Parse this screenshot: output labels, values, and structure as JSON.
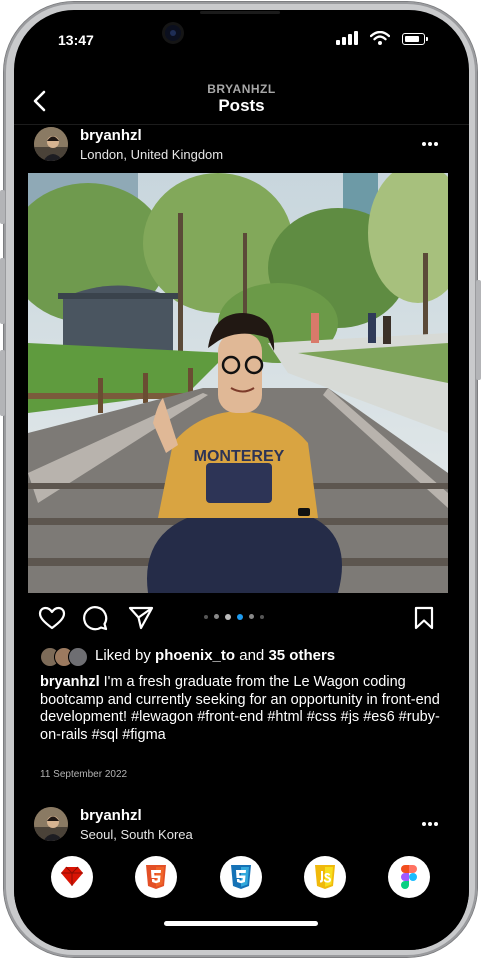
{
  "status_bar": {
    "time": "13:47"
  },
  "header": {
    "username": "BRYANHZL",
    "title": "Posts"
  },
  "post": {
    "username": "bryanhzl",
    "location": "London, United Kingdom",
    "liked_prefix": "Liked by ",
    "liked_user": "phoenix_to",
    "liked_and": " and ",
    "liked_others": "35 others",
    "caption_user": "bryanhzl",
    "caption_text": " I'm a fresh graduate from the Le Wagon coding bootcamp and currently seeking for an opportunity in front-end development! #lewagon #front-end #html #css #js #es6 #ruby-on-rails #sql #figma",
    "date": "11 September 2022",
    "carousel": {
      "count": 5,
      "active_index": 3
    },
    "photo_shirt_text": "MONTEREY"
  },
  "next_post": {
    "username": "bryanhzl",
    "location": "Seoul, South Korea"
  },
  "icons": {
    "back": "chevron-left-icon",
    "more": "more-horizontal-icon",
    "like": "heart-icon",
    "comment": "comment-icon",
    "share": "paper-plane-icon",
    "save": "bookmark-icon"
  },
  "skills": [
    {
      "name": "Ruby",
      "icon": "ruby-icon",
      "color": "#d91404"
    },
    {
      "name": "HTML5",
      "icon": "html5-icon",
      "color": "#e34f26"
    },
    {
      "name": "CSS3",
      "icon": "css3-icon",
      "color": "#1572b6"
    },
    {
      "name": "JS",
      "icon": "javascript-icon",
      "color": "#f7c30f"
    },
    {
      "name": "Figma",
      "icon": "figma-icon",
      "color": "#a259ff"
    }
  ],
  "colors": {
    "background": "#000000",
    "text": "#ffffff",
    "muted": "#a7a7a7",
    "active_dot": "#1d9bf0"
  }
}
